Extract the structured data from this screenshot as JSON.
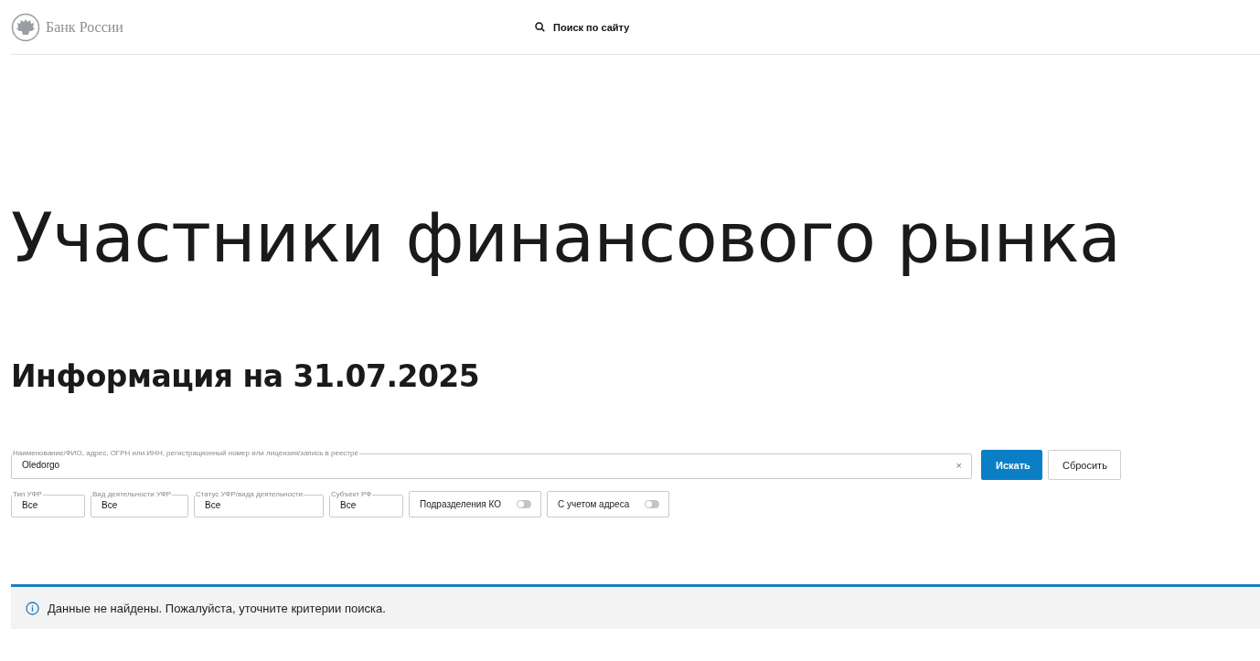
{
  "header": {
    "logo_text": "Банк России",
    "search_label": "Поиск по сайту"
  },
  "title": "Участники финансового рынка",
  "subtitle": "Информация на 31.07.2025",
  "search": {
    "label": "Наименование/ФИО, адрес, ОГРН или ИНН, регистрационный номер или лицензия/запись в реестре",
    "value": "Oledorgo",
    "clear": "×"
  },
  "buttons": [
    {
      "label": "Искать",
      "kind": "primary"
    },
    {
      "label": "Сбросить",
      "kind": "secondary"
    }
  ],
  "filters": [
    {
      "kind": "select",
      "label": "Тип УФР",
      "value": "Все"
    },
    {
      "kind": "select",
      "label": "Вид деятельности УФР",
      "value": "Все"
    },
    {
      "kind": "select",
      "label": "Статус УФР/вида деятельности",
      "value": "Все"
    },
    {
      "kind": "select",
      "label": "Субъект РФ",
      "value": "Все"
    },
    {
      "kind": "toggle",
      "label": "Подразделения КО",
      "on": false
    },
    {
      "kind": "toggle",
      "label": "С учетом адреса",
      "on": false
    }
  ],
  "notice": {
    "text": "Данные не найдены. Пожалуйста, уточните критерии поиска."
  }
}
